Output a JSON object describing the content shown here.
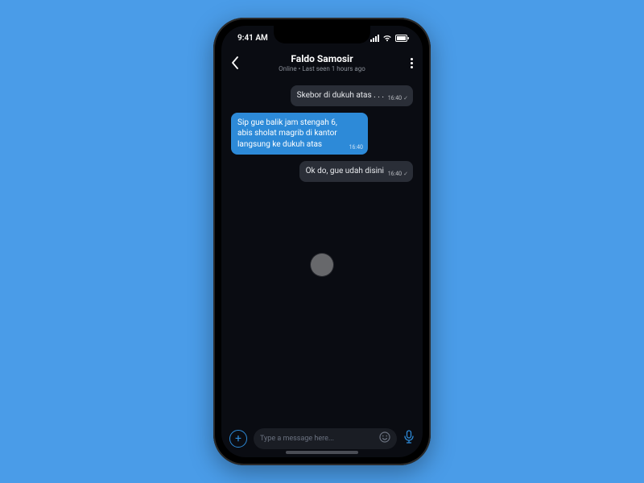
{
  "statusbar": {
    "time": "9:41 AM"
  },
  "header": {
    "contact_name": "Faldo Samosir",
    "status_line": "Online • Last seen 1 hours ago"
  },
  "messages": [
    {
      "side": "incoming",
      "text": "Skebor di dukuh atas . . .",
      "time": "16:40",
      "read": true
    },
    {
      "side": "outgoing",
      "text": "Sip gue balik jam stengah 6, abis sholat magrib di kantor langsung ke dukuh atas",
      "time": "16:40",
      "read": false
    },
    {
      "side": "incoming",
      "text": "Ok do, gue udah disini",
      "time": "16:40",
      "read": true
    }
  ],
  "input": {
    "placeholder": "Type a message here..."
  }
}
